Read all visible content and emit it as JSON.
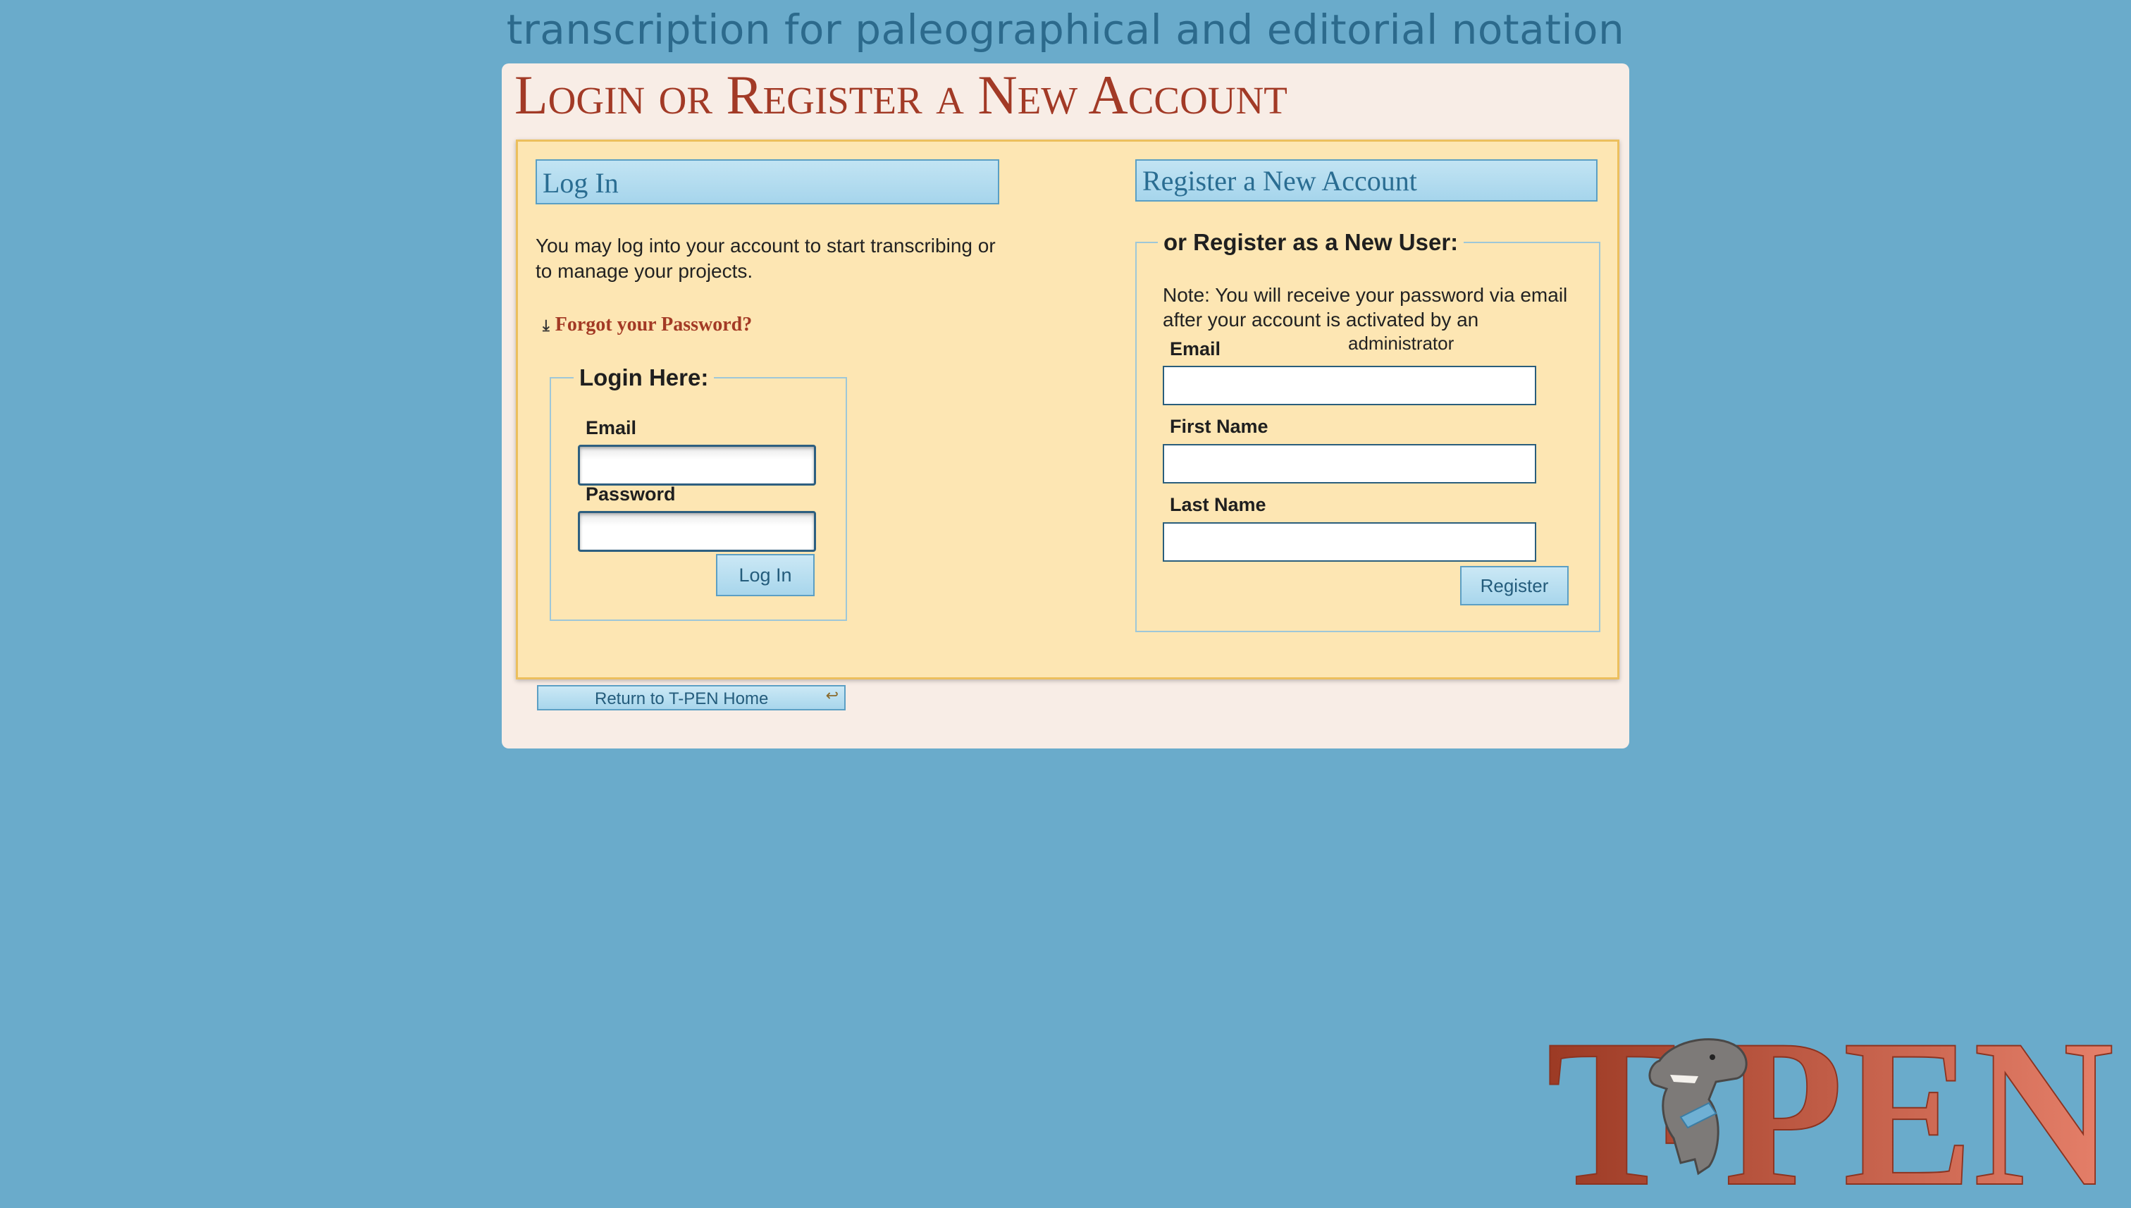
{
  "tagline": "transcription for paleographical and editorial notation",
  "page_title": "Login or Register a New Account",
  "login": {
    "header": "Log In",
    "intro": "You may log into your account to start transcribing or to manage your projects.",
    "forgot_icon": "download-arrow-icon",
    "forgot_label": "Forgot your Password?",
    "legend": "Login Here:",
    "email_label": "Email",
    "email_value": "",
    "password_label": "Password",
    "password_value": "",
    "submit_label": "Log In"
  },
  "register": {
    "header": "Register a New Account",
    "legend": "or Register as a New User:",
    "note_line1": "Note: You will receive your password via email",
    "note_line2": "after your account is activated by an",
    "note_line3": "administrator",
    "email_label": "Email",
    "email_value": "",
    "first_name_label": "First Name",
    "first_name_value": "",
    "last_name_label": "Last Name",
    "last_name_value": "",
    "submit_label": "Register"
  },
  "return_home": {
    "label": "Return to T-PEN Home",
    "icon": "return-arrow-icon"
  },
  "logo": {
    "text": "T-PEN",
    "icon": "dinosaur-icon",
    "colors": {
      "dark": "#9c3a24",
      "light": "#e6806a"
    }
  }
}
